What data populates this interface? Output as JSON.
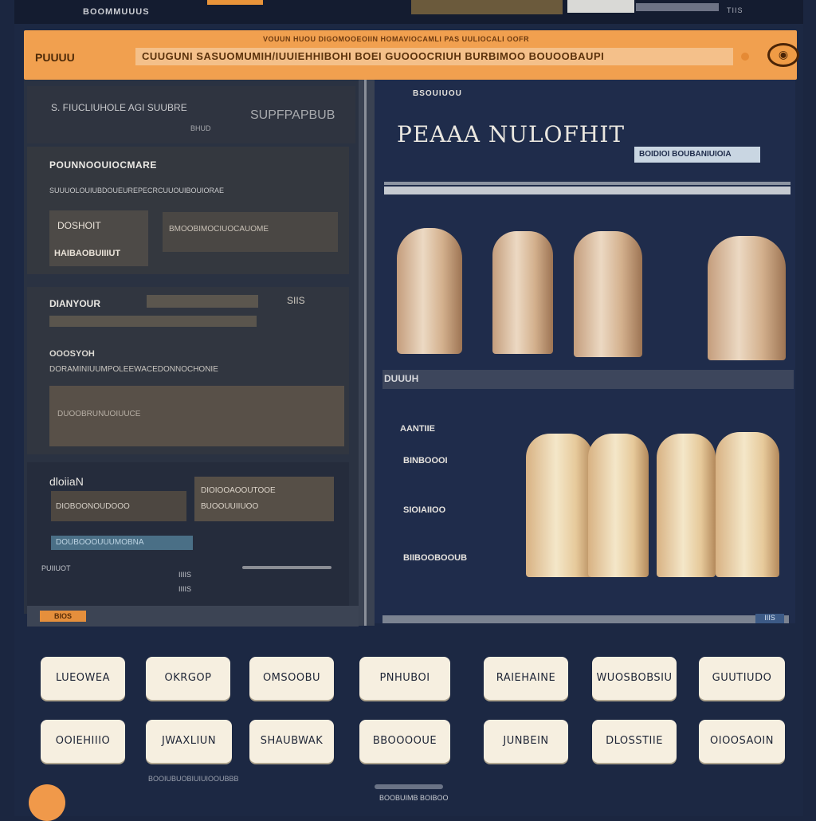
{
  "topbar": {
    "title": "BOOMMUUUS",
    "status": "TIIS"
  },
  "search": {
    "caption": "VOUUN HUOU DIGOMOOEOIIN HOMAVIOCAMLI PAS UULIOCALI OOFR",
    "label": "PUUUU",
    "value": "CUUGUNI SASUOMUMIH/IUUIEHHIBOHI BOEI GUOOOCRIUH BURBIMOO BOUOOBAUPI",
    "badge_icon": "search-icon"
  },
  "left_panel": {
    "section1": {
      "line1": "S. FIUCLIUHOLE AGI SUUBRE",
      "line2": "SUPFPAPBUB",
      "line3": "BHUD"
    },
    "section2": {
      "heading": "POUNNOOUIOCMARE",
      "subtext": "SUUUOLOUIUBDOUEUREPECRCUUOUIBOUIORAE",
      "box_line1": "DOSHOIT",
      "box_line2": "HAIBAOBUIIIUT",
      "field": "BMOOBIMOCIUOCAUOME"
    },
    "section3": {
      "heading": "DIANYOUR",
      "value": "SIIS",
      "line1": "OOOSYOH",
      "line2": "DORAMINIUUMPOLEEWACEDONNOCHONIE",
      "field": "DUOOBRUNUOIUUCE"
    },
    "section4": {
      "heading": "dloiiaN",
      "field1": "DIOBOONOUDOOO",
      "field2_line1": "DIOIOOAOOUTOOE",
      "field2_line2": "BUOOUUIIUOO",
      "link": "DOUBOOOUUUMOBNA",
      "footer1": "PUIIUOT",
      "footer2": "IIIIS",
      "footer3": "IIIIS"
    },
    "footer_tag": "BIOS"
  },
  "right_panel": {
    "small_label": "BSOUIUOU",
    "title": "PEAAA NULOFHIT",
    "pill": "BOIDIOI BOUBANIUIOIA",
    "section_label": "DUUUH",
    "list_title": "AANTIIE",
    "list_items": [
      "BINBOOOI",
      "SIOIAIIOO",
      "BIIBOOBOOUB"
    ],
    "bottom_key": "IIIS"
  },
  "buttons_row1": [
    "LUEOWEA",
    "OKRGOP",
    "OMSOOBU",
    "PNHUBOI",
    "RAIEHAINE",
    "WUOSBOBSIU",
    "GUUTIUDO"
  ],
  "buttons_row2": [
    "OOIEHIIIO",
    "JWAXLIUN",
    "SHAUBWAK",
    "BBOOOOUE",
    "JUNBEIN",
    "DLOSSTIIE",
    "OIOOSAOIN"
  ],
  "footer": {
    "label": "BOOBUIMB BOIBOO",
    "sub": "BOOIUBUOBIUIUIOOUBBB"
  },
  "colors": {
    "accent": "#f1a04f",
    "navy": "#1f2c4b",
    "button": "#f6efe0"
  }
}
